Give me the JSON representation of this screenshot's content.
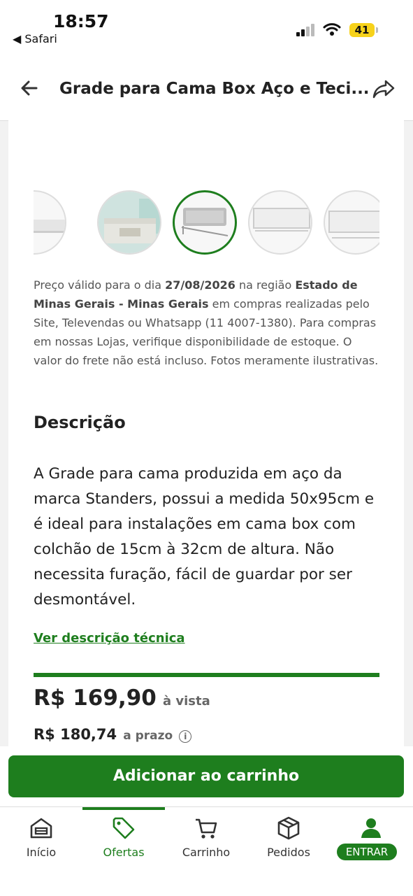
{
  "status_bar": {
    "time": "18:57",
    "back_app": "◀ Safari",
    "battery": "41"
  },
  "header": {
    "title": "Grade para Cama Box Aço e Teci..."
  },
  "gallery": {
    "thumbnails": [
      "thumb-1",
      "thumb-2",
      "thumb-3",
      "thumb-4",
      "thumb-5"
    ],
    "selected_index": 2
  },
  "price_note": {
    "t1": "Preço válido para o dia ",
    "date": "27/08/2026",
    "t2": " na região ",
    "region": "Estado de Minas Gerais - Minas Gerais",
    "t3": " em compras realizadas pelo Site, Televendas ou Whatsapp (11 4007-1380). Para compras em nossas Lojas, verifique disponibilidade de estoque. O valor do frete não está incluso. Fotos meramente ilustrativas."
  },
  "description": {
    "title": "Descrição",
    "text": "A Grade para cama produzida em aço da marca Standers, possui a medida 50x95cm e é ideal para instalações em cama box com colchão de 15cm à 32cm de altura. Não necessita furação, fácil de guardar por ser desmontável.",
    "tech_link": "Ver descrição técnica"
  },
  "pricing": {
    "cash_price": "R$ 169,90",
    "cash_label": "à vista",
    "installment_price": "R$ 180,74",
    "installment_label": "a prazo",
    "info_icon": "i"
  },
  "cart": {
    "add_label": "Adicionar ao carrinho"
  },
  "nav": {
    "items": [
      {
        "label": "Início",
        "icon": "home-icon"
      },
      {
        "label": "Ofertas",
        "icon": "tag-icon"
      },
      {
        "label": "Carrinho",
        "icon": "cart-icon"
      },
      {
        "label": "Pedidos",
        "icon": "box-icon"
      },
      {
        "label": "ENTRAR",
        "icon": "user-icon"
      }
    ],
    "active_index": 1
  },
  "colors": {
    "accent": "#1e7e1e",
    "battery": "#f7d21b"
  }
}
